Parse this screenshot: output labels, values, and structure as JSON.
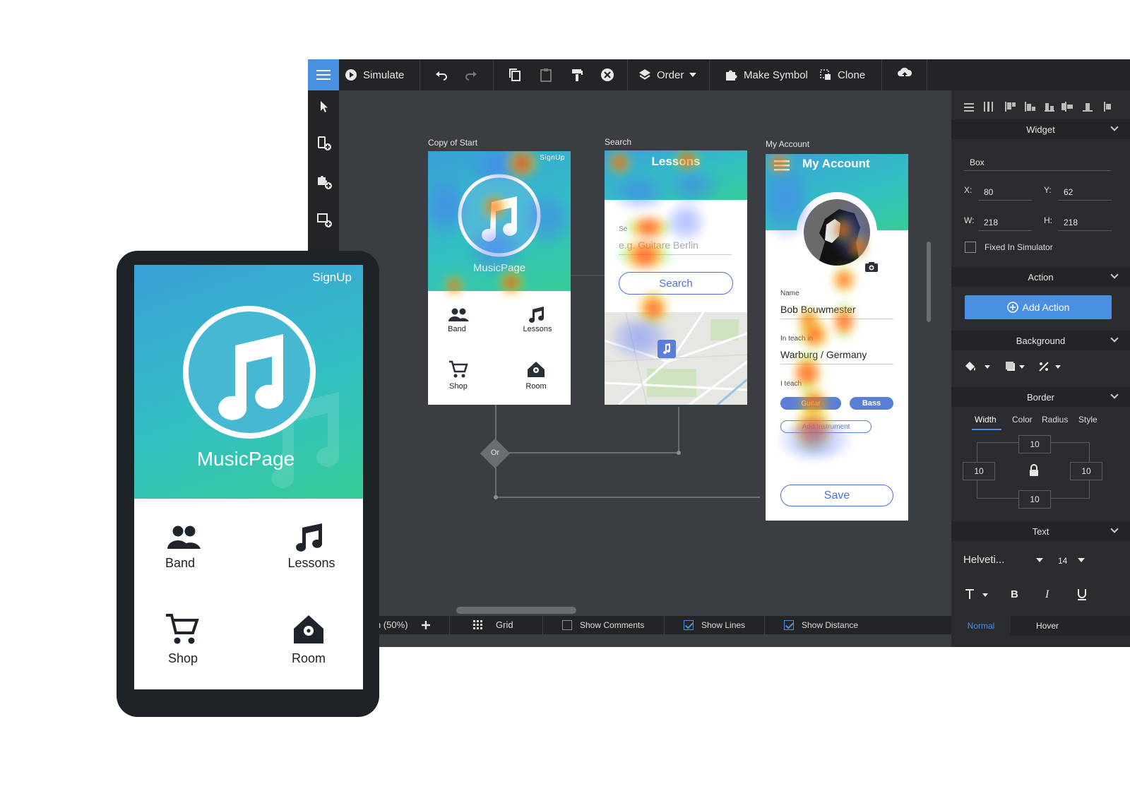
{
  "toolbar": {
    "simulate": "Simulate",
    "order": "Order",
    "make_symbol": "Make Symbol",
    "clone": "Clone"
  },
  "canvas": {
    "screen1": {
      "label": "Copy of Start",
      "signup": "SignUp",
      "title": "MusicPage",
      "items": [
        "Band",
        "Lessons",
        "Shop",
        "Room"
      ]
    },
    "screen2": {
      "label": "Search",
      "header": "Lessons",
      "search_label": "Se",
      "placeholder": "e.g. Guitare Berlin",
      "search_button": "Search"
    },
    "screen3": {
      "label": "My Account",
      "header": "My Account",
      "name_label": "Name",
      "name_value": "Bob Bouwmester",
      "teach_in_label": "In teach in",
      "teach_in_value": "Warburg / Germany",
      "i_teach_label": "I teach",
      "tag_guitar": "Guitar",
      "tag_bass": "Bass",
      "tag_add": "Add Instrument",
      "save": "Save"
    },
    "or_node": "Or"
  },
  "statusbar": {
    "zoom": "Zoom (50%)",
    "grid": "Grid",
    "show_comments": "Show Comments",
    "show_lines": "Show Lines",
    "show_distance": "Show Distance",
    "show_comments_checked": false,
    "show_lines_checked": true,
    "show_distance_checked": true
  },
  "panel": {
    "widget_header": "Widget",
    "widget_name": "Box",
    "x_label": "X:",
    "x_value": "80",
    "y_label": "Y:",
    "y_value": "62",
    "w_label": "W:",
    "w_value": "218",
    "h_label": "H:",
    "h_value": "218",
    "fixed_label": "Fixed In Simulator",
    "action_header": "Action",
    "add_action": "Add Action",
    "background_header": "Background",
    "border_header": "Border",
    "border_tabs": [
      "Width",
      "Color",
      "Radius",
      "Style"
    ],
    "border_values": {
      "top": "10",
      "left": "10",
      "right": "10",
      "bottom": "10"
    },
    "text_header": "Text",
    "font": "Helveti...",
    "font_size": "14",
    "state_tabs": [
      "Normal",
      "Hover"
    ]
  },
  "tablet": {
    "signup": "SignUp",
    "title": "MusicPage",
    "items": [
      "Band",
      "Lessons",
      "Shop",
      "Room"
    ]
  },
  "colors": {
    "accent": "#4a90e2",
    "toolbar_bg": "#222427",
    "canvas_bg": "#3a3d41",
    "gradient_start": "#3aa0d8",
    "gradient_end": "#36cc97"
  }
}
